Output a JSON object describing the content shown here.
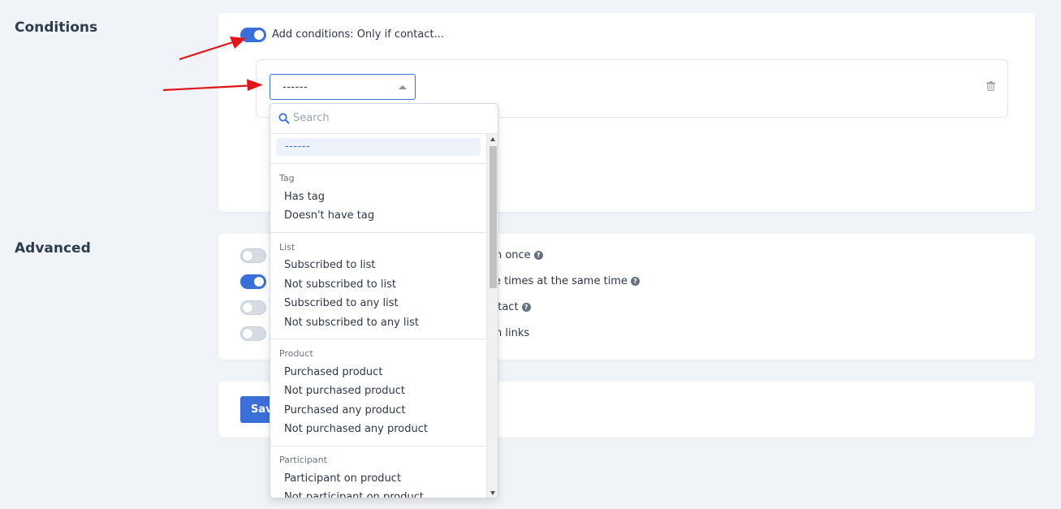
{
  "conditions": {
    "title": "Conditions",
    "toggle_label": "Add conditions: Only if contact...",
    "toggle_on": true,
    "select_value": "------"
  },
  "dropdown": {
    "search_placeholder": "Search",
    "selected": "------",
    "groups": [
      {
        "label": "Tag",
        "items": [
          "Has tag",
          "Doesn't have tag"
        ]
      },
      {
        "label": "List",
        "items": [
          "Subscribed to list",
          "Not subscribed to list",
          "Subscribed to any list",
          "Not subscribed to any list"
        ]
      },
      {
        "label": "Product",
        "items": [
          "Purchased product",
          "Not purchased product",
          "Purchased any product",
          "Not purchased any product"
        ]
      },
      {
        "label": "Participant",
        "items": [
          "Participant on product",
          "Not participant on product"
        ]
      }
    ]
  },
  "advanced": {
    "title": "Advanced",
    "options": [
      {
        "label_visible": "on once",
        "on": false,
        "help": true
      },
      {
        "label_visible": "e times at the same time",
        "on": true,
        "help": true
      },
      {
        "label_visible": "ntact",
        "on": false,
        "help": true
      },
      {
        "label_visible": "n links",
        "on": false,
        "help": false
      }
    ]
  },
  "footer": {
    "save_label": "Save"
  },
  "icons": {
    "search": "search-icon",
    "trash": "trash-icon",
    "help": "help-icon"
  },
  "colors": {
    "accent": "#3b6fd8",
    "arrow": "#e0161b"
  }
}
